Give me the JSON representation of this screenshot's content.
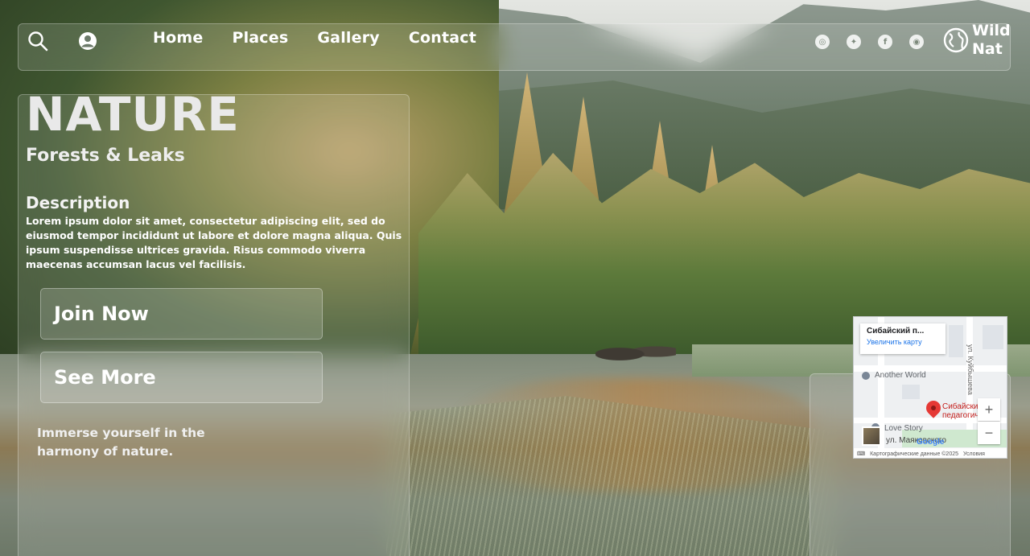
{
  "nav": {
    "links": [
      "Home",
      "Places",
      "Gallery",
      "Contact"
    ],
    "icons": [
      "search-icon",
      "user-icon"
    ],
    "social": [
      {
        "name": "whatsapp-icon",
        "glyph": "◎"
      },
      {
        "name": "twitter-icon",
        "glyph": "✦"
      },
      {
        "name": "facebook-icon",
        "glyph": "f"
      },
      {
        "name": "instagram-icon",
        "glyph": "◉"
      }
    ],
    "brand_line1": "Wild",
    "brand_line2": "Nat"
  },
  "hero": {
    "title": "NATURE",
    "subtitle": "Forests & Leaks",
    "description_heading": "Description",
    "description": "Lorem ipsum dolor sit amet, consectetur adipiscing elit, sed do eiusmod tempor incididunt ut labore et dolore magna aliqua. Quis ipsum suspendisse ultrices gravida. Risus commodo viverra maecenas accumsan lacus vel facilisis.",
    "join_label": "Join Now",
    "more_label": "See More",
    "tagline": "Immerse yourself in the harmony of nature."
  },
  "map": {
    "card_title": "Сибайский п...",
    "card_link": "Увеличить карту",
    "poi_1": "Another World",
    "poi_2": "Love Story",
    "pin_label": "Сибайский педагогиче...",
    "street": "ул. Маяковского",
    "vertical_street": "ул. Куйбышева",
    "zoom_in": "+",
    "zoom_out": "−",
    "google": "Google",
    "footer_data": "Картографические данные ©2025",
    "footer_terms": "Условия",
    "keyboard_icon": "⌨"
  },
  "colors": {
    "accent": "#ffffff",
    "pin": "#e53935",
    "map_link": "#1a73e8"
  }
}
